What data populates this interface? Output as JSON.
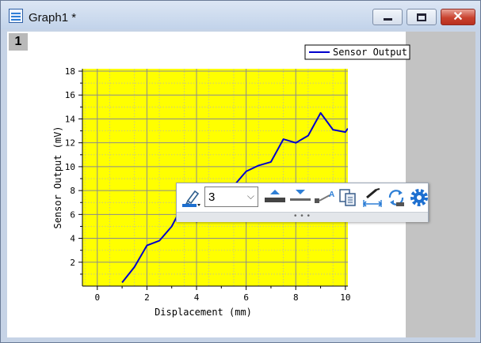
{
  "window": {
    "title": "Graph1 *",
    "minimize_glyph": "",
    "maximize_glyph": "",
    "close_glyph": "✕",
    "icon": "graph-window-icon"
  },
  "layer": {
    "number": "1"
  },
  "chart_data": {
    "type": "line",
    "title": "",
    "xlabel": "Displacement (mm)",
    "ylabel": "Sensor Output (mV)",
    "xlim": [
      -0.6,
      10.1
    ],
    "ylim": [
      0,
      18.2
    ],
    "xticks": [
      "0",
      "2",
      "4",
      "6",
      "8",
      "10"
    ],
    "yticks": [
      "2",
      "4",
      "6",
      "8",
      "10",
      "12",
      "14",
      "16",
      "18"
    ],
    "grid": true,
    "plot_background": "#ffff00",
    "legend_position": "top-right",
    "series": [
      {
        "name": "Sensor Output",
        "color": "#0000cc",
        "x": [
          1.0,
          1.5,
          2.0,
          2.5,
          3.0,
          3.5,
          4.0,
          4.5,
          5.0,
          5.5,
          6.0,
          6.5,
          7.0,
          7.5,
          8.0,
          8.5,
          9.0,
          9.5,
          10.0,
          10.1
        ],
        "y": [
          0.3,
          1.6,
          3.4,
          3.8,
          5.0,
          7.0,
          5.4,
          5.7,
          7.5,
          8.4,
          9.6,
          10.1,
          10.4,
          12.3,
          12.0,
          12.6,
          14.5,
          13.1,
          12.9,
          13.2
        ]
      }
    ]
  },
  "toolbar": {
    "line_width_value": "3",
    "combo_arrow": "⌵",
    "grip": "• • •",
    "icons": [
      "line-color-icon",
      "line-width-combo",
      "increase-width-icon",
      "decrease-width-icon",
      "connect-line-icon",
      "copy-format-icon",
      "distance-icon",
      "swap-icon",
      "settings-gear-icon"
    ]
  },
  "colors": {
    "accent": "#2e7fd6",
    "close": "#c9422f",
    "plot_bg": "#ffff00",
    "line": "#0000cc"
  }
}
